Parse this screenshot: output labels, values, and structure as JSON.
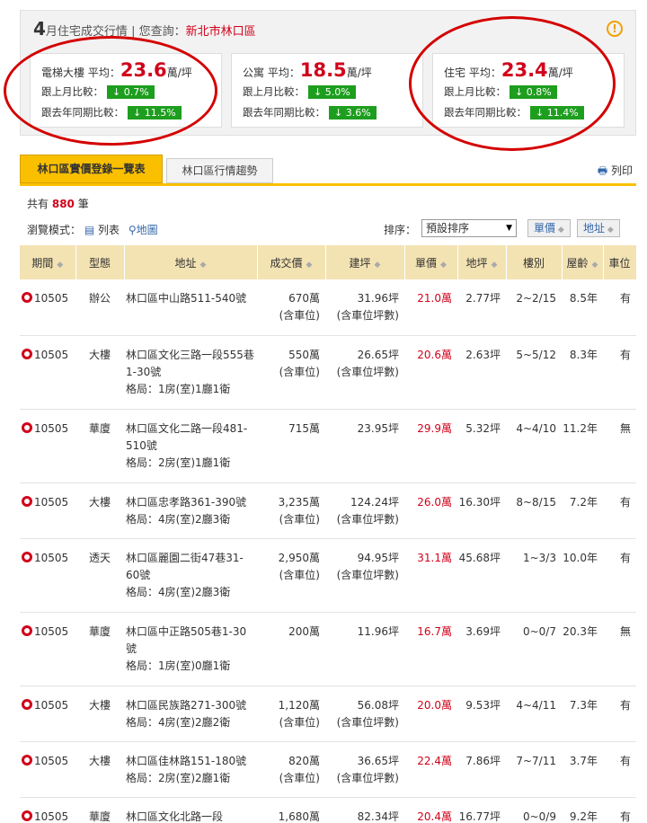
{
  "summary": {
    "month": "4",
    "title_mid": "月住宅成交行情",
    "query_label": "您查詢：",
    "location": "新北市林口區",
    "warn_icon": "!",
    "cards": [
      {
        "type": "電梯大樓",
        "avg_label": "平均：",
        "avg": "23.6",
        "unit": "萬/坪",
        "mom_label": "跟上月比較：",
        "mom": "↓ 0.7%",
        "yoy_label": "跟去年同期比較：",
        "yoy": "↓ 11.5%"
      },
      {
        "type": "公寓",
        "avg_label": "平均：",
        "avg": "18.5",
        "unit": "萬/坪",
        "mom_label": "跟上月比較：",
        "mom": "↓ 5.0%",
        "yoy_label": "跟去年同期比較：",
        "yoy": "↓ 3.6%"
      },
      {
        "type": "住宅",
        "avg_label": "平均：",
        "avg": "23.4",
        "unit": "萬/坪",
        "mom_label": "跟上月比較：",
        "mom": "↓ 0.8%",
        "yoy_label": "跟去年同期比較：",
        "yoy": "↓ 11.4%"
      }
    ]
  },
  "tabs": [
    "林口區實價登錄一覽表",
    "林口區行情趨勢"
  ],
  "print_label": "列印",
  "count": {
    "prefix": "共有",
    "value": "880",
    "suffix": "筆"
  },
  "view": {
    "label": "瀏覽模式：",
    "list": "列表",
    "map": "地圖"
  },
  "sort": {
    "label": "排序：",
    "selected": "預設排序",
    "btn_unit": "單價",
    "btn_addr": "地址"
  },
  "columns": [
    "期間",
    "型態",
    "地址",
    "成交價",
    "建坪",
    "單價",
    "地坪",
    "樓別",
    "屋齡",
    "車位"
  ],
  "rows": [
    {
      "period": "10505",
      "type": "辦公",
      "addr": "林口區中山路511-540號",
      "layout": "",
      "price": "670萬",
      "price_sub": "(含車位)",
      "area": "31.96坪",
      "area_sub": "(含車位坪數)",
      "unit": "21.0萬",
      "land": "2.77坪",
      "floor": "2~2/15",
      "age": "8.5年",
      "parking": "有"
    },
    {
      "period": "10505",
      "type": "大樓",
      "addr": "林口區文化三路一段555巷1-30號",
      "layout": "格局：1房(室)1廳1衛",
      "price": "550萬",
      "price_sub": "(含車位)",
      "area": "26.65坪",
      "area_sub": "(含車位坪數)",
      "unit": "20.6萬",
      "land": "2.63坪",
      "floor": "5~5/12",
      "age": "8.3年",
      "parking": "有"
    },
    {
      "period": "10505",
      "type": "華廈",
      "addr": "林口區文化二路一段481-510號",
      "layout": "格局：2房(室)1廳1衛",
      "price": "715萬",
      "price_sub": "",
      "area": "23.95坪",
      "area_sub": "",
      "unit": "29.9萬",
      "land": "5.32坪",
      "floor": "4~4/10",
      "age": "11.2年",
      "parking": "無"
    },
    {
      "period": "10505",
      "type": "大樓",
      "addr": "林口區忠孝路361-390號",
      "layout": "格局：4房(室)2廳3衛",
      "price": "3,235萬",
      "price_sub": "(含車位)",
      "area": "124.24坪",
      "area_sub": "(含車位坪數)",
      "unit": "26.0萬",
      "land": "16.30坪",
      "floor": "8~8/15",
      "age": "7.2年",
      "parking": "有"
    },
    {
      "period": "10505",
      "type": "透天",
      "addr": "林口區麗園二街47巷31-60號",
      "layout": "格局：4房(室)2廳3衛",
      "price": "2,950萬",
      "price_sub": "(含車位)",
      "area": "94.95坪",
      "area_sub": "(含車位坪數)",
      "unit": "31.1萬",
      "land": "45.68坪",
      "floor": "1~3/3",
      "age": "10.0年",
      "parking": "有"
    },
    {
      "period": "10505",
      "type": "華廈",
      "addr": "林口區中正路505巷1-30號",
      "layout": "格局：1房(室)0廳1衛",
      "price": "200萬",
      "price_sub": "",
      "area": "11.96坪",
      "area_sub": "",
      "unit": "16.7萬",
      "land": "3.69坪",
      "floor": "0~0/7",
      "age": "20.3年",
      "parking": "無"
    },
    {
      "period": "10505",
      "type": "大樓",
      "addr": "林口區民族路271-300號",
      "layout": "格局：4房(室)2廳2衛",
      "price": "1,120萬",
      "price_sub": "(含車位)",
      "area": "56.08坪",
      "area_sub": "(含車位坪數)",
      "unit": "20.0萬",
      "land": "9.53坪",
      "floor": "4~4/11",
      "age": "7.3年",
      "parking": "有"
    },
    {
      "period": "10505",
      "type": "大樓",
      "addr": "林口區佳林路151-180號",
      "layout": "格局：2房(室)2廳1衛",
      "price": "820萬",
      "price_sub": "(含車位)",
      "area": "36.65坪",
      "area_sub": "(含車位坪數)",
      "unit": "22.4萬",
      "land": "7.86坪",
      "floor": "7~7/11",
      "age": "3.7年",
      "parking": "有"
    },
    {
      "period": "10505",
      "type": "華廈",
      "addr": "林口區文化北路一段",
      "layout": "",
      "price": "1,680萬",
      "price_sub": "",
      "area": "82.34坪",
      "area_sub": "",
      "unit": "20.4萬",
      "land": "16.77坪",
      "floor": "0~0/9",
      "age": "9.2年",
      "parking": "有"
    }
  ]
}
